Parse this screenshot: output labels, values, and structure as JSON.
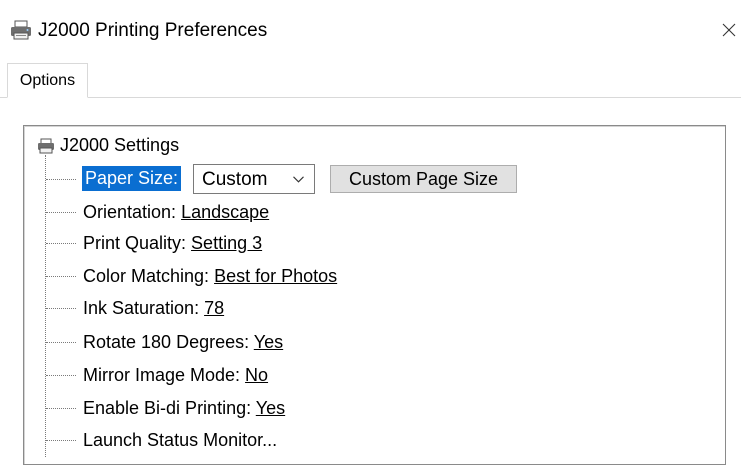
{
  "window": {
    "title": "J2000 Printing Preferences"
  },
  "tabs": [
    {
      "label": "Options"
    }
  ],
  "tree": {
    "root_label": "J2000 Settings",
    "paper_size": {
      "label": "Paper Size:",
      "value": "Custom",
      "button_label": "Custom Page Size"
    },
    "items": [
      {
        "label": "Orientation: ",
        "value": "Landscape"
      },
      {
        "label": "Print Quality: ",
        "value": "Setting 3"
      },
      {
        "label": "Color Matching: ",
        "value": "Best for Photos"
      },
      {
        "label": "Ink Saturation: ",
        "value": "78"
      },
      {
        "label": "Rotate 180 Degrees: ",
        "value": "Yes"
      },
      {
        "label": "Mirror Image Mode: ",
        "value": "No"
      },
      {
        "label": "Enable Bi-di Printing: ",
        "value": "Yes"
      }
    ],
    "launch_label": "Launch Status Monitor..."
  },
  "icons": {
    "title": "printer-icon",
    "root": "printer-icon",
    "close": "close-icon",
    "dropdown": "chevron-down-icon"
  },
  "colors": {
    "selection": "#0a6ed1",
    "button_face": "#e1e1e1"
  }
}
